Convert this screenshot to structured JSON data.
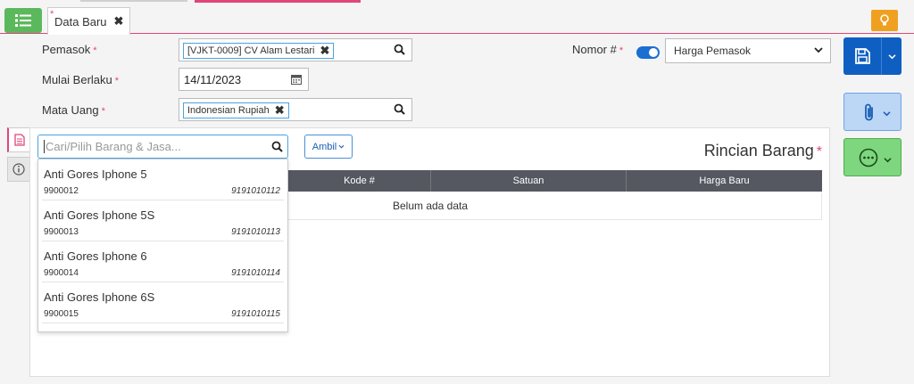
{
  "tab": {
    "title": "Data Baru",
    "dirty_marker": "*"
  },
  "form": {
    "pemasok_label": "Pemasok",
    "pemasok_value": "[VJKT-0009] CV Alam Lestari",
    "mulai_label": "Mulai Berlaku",
    "mulai_value": "14/11/2023",
    "mata_uang_label": "Mata Uang",
    "mata_uang_value": "Indonesian Rupiah",
    "nomor_label": "Nomor #",
    "nomor_toggle_on": true,
    "harga_select_value": "Harga Pemasok",
    "required_marker": "*"
  },
  "panel": {
    "search_placeholder": "Cari/Pilih Barang & Jasa...",
    "ambil_label": "Ambil",
    "title": "Rincian Barang",
    "columns": [
      "Kode #",
      "Satuan",
      "Harga Baru"
    ],
    "empty_text": "Belum ada data"
  },
  "dropdown_items": [
    {
      "name": "Anti Gores Iphone 5",
      "code": "9900012",
      "barcode": "9191010112"
    },
    {
      "name": "Anti Gores Iphone 5S",
      "code": "9900013",
      "barcode": "9191010113"
    },
    {
      "name": "Anti Gores Iphone 6",
      "code": "9900014",
      "barcode": "9191010114"
    },
    {
      "name": "Anti Gores Iphone 6S",
      "code": "9900015",
      "barcode": "9191010115"
    }
  ],
  "colors": {
    "accent_pink": "#e0457b",
    "primary_blue": "#0f5fc2",
    "green": "#5cb85c",
    "orange": "#f0a020"
  },
  "icons": [
    "list-icon",
    "close-icon",
    "bulb-icon",
    "search-icon",
    "calendar-icon",
    "save-icon",
    "paperclip-icon",
    "more-icon",
    "chevron-down-icon",
    "document-icon",
    "info-icon"
  ]
}
